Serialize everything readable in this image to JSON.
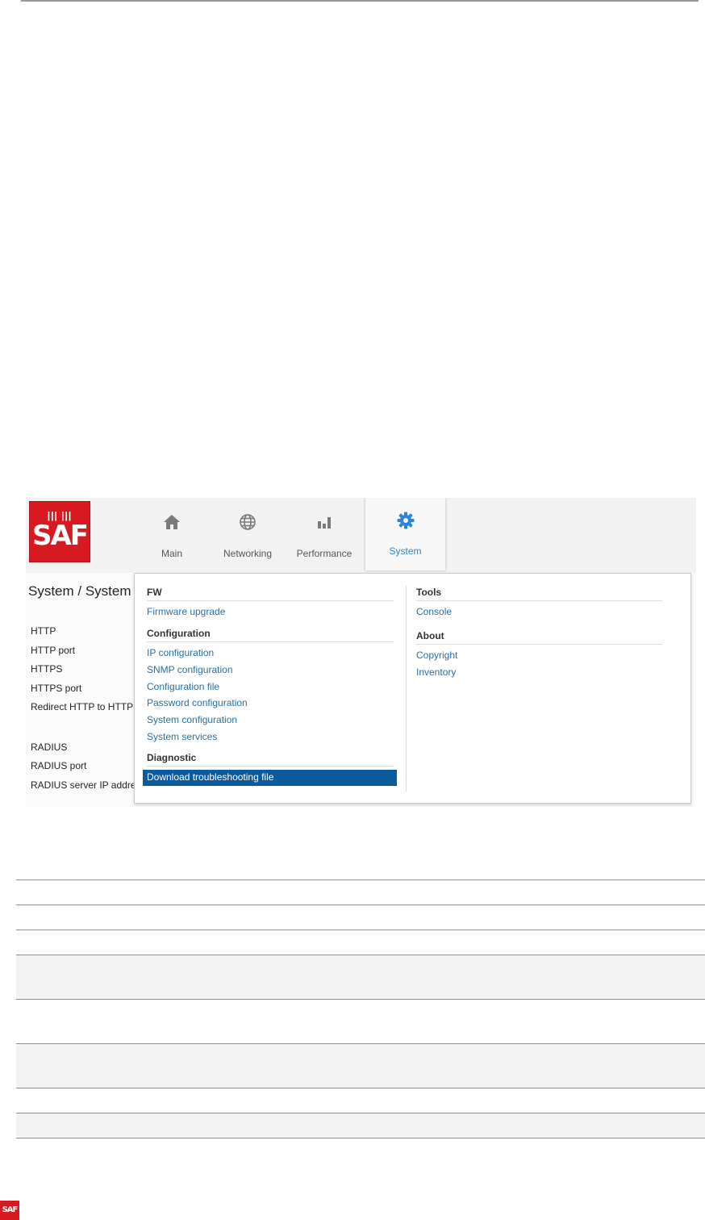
{
  "brand": {
    "logo_text": "SAF",
    "logo_bars": "||| |||"
  },
  "nav": [
    {
      "label": "Main",
      "icon": "home-icon"
    },
    {
      "label": "Networking",
      "icon": "globe-icon"
    },
    {
      "label": "Performance",
      "icon": "bar-chart-icon"
    },
    {
      "label": "System",
      "icon": "gear-icon"
    }
  ],
  "page_title": "System / System",
  "form_labels": [
    "HTTP",
    "HTTP port",
    "HTTPS",
    "HTTPS port",
    "Redirect HTTP to HTTPS",
    "RADIUS",
    "RADIUS port",
    "RADIUS server IP address"
  ],
  "menu": {
    "fw": {
      "heading": "FW",
      "items": [
        "Firmware upgrade"
      ]
    },
    "configuration": {
      "heading": "Configuration",
      "items": [
        "IP configuration",
        "SNMP configuration",
        "Configuration file",
        "Password configuration",
        "System configuration",
        "System services"
      ]
    },
    "diagnostic": {
      "heading": "Diagnostic",
      "items": [
        "Download troubleshooting file"
      ]
    },
    "tools": {
      "heading": "Tools",
      "items": [
        "Console"
      ]
    },
    "about": {
      "heading": "About",
      "items": [
        "Copyright",
        "Inventory"
      ]
    }
  },
  "colors": {
    "accent": "#2a86d6",
    "highlight": "#0b5a9c",
    "brand_red": "#d71920",
    "link": "#2a6fa8"
  }
}
